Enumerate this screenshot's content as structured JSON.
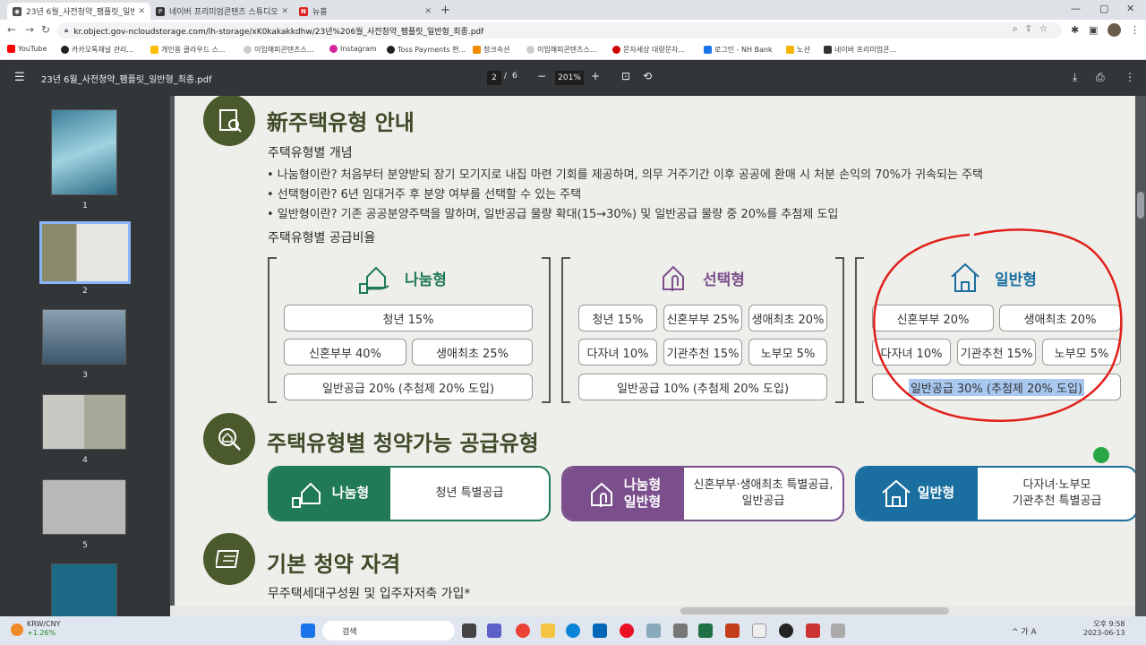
{
  "browser": {
    "tabs": [
      {
        "title": "23년 6월_사전청약_팸플릿_일반",
        "active": true
      },
      {
        "title": "네이버 프리미엄콘텐츠 스튜디오",
        "active": false
      },
      {
        "title": "뉴홈",
        "active": false
      }
    ],
    "new_tab": "+",
    "url": "kr.object.gov-ncloudstorage.com/lh-storage/xK0kakakkdhw/23년%206월_사전청약_팸플릿_일반형_최종.pdf",
    "bookmarks": [
      "YouTube",
      "카카오톡채널 관리...",
      "개인용 클라우드 스...",
      "이임해피콘텐츠스...",
      "Instagram",
      "Toss Payments 현...",
      "청크속션",
      "이임해피콘텐츠스...",
      "문자세상 대량문자...",
      "로그인 - NH Bank",
      "노션",
      "네이버 프리미엄콘..."
    ]
  },
  "pdf": {
    "menu_icon": "menu-icon",
    "filename": "23년 6월_사전청약_팸플릿_일반형_최종.pdf",
    "current_page": "2",
    "page_sep": "/",
    "total_pages": "6",
    "zoom": "201%",
    "thumbnails": [
      "1",
      "2",
      "3",
      "4",
      "5"
    ]
  },
  "content": {
    "section1_title": "新주택유형 안내",
    "concept_heading": "주택유형별 개념",
    "bullets": [
      "• 나눔형이란? 처음부터 분양받되 장기 모기지로 내집 마련 기회를 제공하며, 의무 거주기간 이후 공공에 환매 시 처분 손익의 70%가 귀속되는 주택",
      "• 선택형이란? 6년 임대거주 후 분양 여부를 선택할 수 있는 주택",
      "• 일반형이란? 기존 공공분양주택을 말하며, 일반공급 물량 확대(15→30%) 및 일반공급 물량 중 20%를 추첨제 도입"
    ],
    "ratio_heading": "주택유형별 공급비율",
    "boxes": {
      "nanum": {
        "title": "나눔형",
        "items": [
          "청년 15%",
          "신혼부부 40%",
          "생애최초 25%",
          "일반공급 20% (추첨제 20% 도입)"
        ]
      },
      "seontaek": {
        "title": "선택형",
        "items": [
          "청년 15%",
          "신혼부부 25%",
          "생애최초 20%",
          "다자녀 10%",
          "기관추천 15%",
          "노부모 5%",
          "일반공급 10% (추첨제 20% 도입)"
        ]
      },
      "ilban": {
        "title": "일반형",
        "items": [
          "신혼부부 20%",
          "생애최초 20%",
          "다자녀 10%",
          "기관추천 15%",
          "노부모 5%",
          "일반공급 30% (추첨제 20% 도입)"
        ]
      }
    },
    "section2_title": "주택유형별 청약가능 공급유형",
    "cards": [
      {
        "label": "나눔형",
        "text": "청년 특별공급",
        "color": "#1f7a55"
      },
      {
        "label1": "나눔형",
        "label2": "일반형",
        "text1": "신혼부부·생애최초 특별공급,",
        "text2": "일반공급",
        "color": "#7a4f8c"
      },
      {
        "label": "일반형",
        "text1": "다자녀·노부모",
        "text2": "기관추천 특별공급",
        "color": "#1b6fa0"
      }
    ],
    "section3_title": "기본 청약 자격",
    "section3_sub": "무주택세대구성원 및 입주자저축 가입*"
  },
  "colors": {
    "olive": "#4b5a2c",
    "nanum_green": "#1f7a55",
    "seontaek_purple": "#7a4f8c",
    "ilban_blue": "#1b6fa0",
    "annotation_red": "#e0201b",
    "highlight": "#a8c8f0"
  },
  "taskbar": {
    "weather_label": "KRW/CNY",
    "weather_value": "+1.26%",
    "search": "검색",
    "time": "오후 9:58",
    "date": "2023-06-13",
    "tray": "^  가  A"
  }
}
